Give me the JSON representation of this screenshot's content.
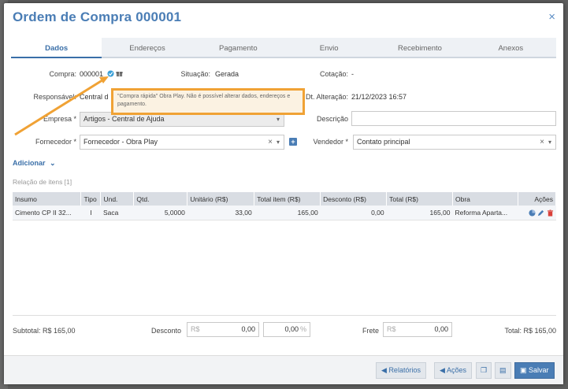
{
  "window": {
    "title": "Ordem de Compra 000001",
    "close": "×"
  },
  "tabs": [
    "Dados",
    "Endereços",
    "Pagamento",
    "Envio",
    "Recebimento",
    "Anexos"
  ],
  "header": {
    "compra_label": "Compra:",
    "compra_value": "000001",
    "situacao_label": "Situação:",
    "situacao_value": "Gerada",
    "cotacao_label": "Cotação:",
    "cotacao_value": "-",
    "responsavel_label": "Responsável:",
    "responsavel_value": "Central d",
    "dt_alteracao_label": "Dt. Alteração:",
    "dt_alteracao_value": "21/12/2023 16:57",
    "empresa_label": "Empresa *",
    "empresa_value": "Artigos - Central de Ajuda",
    "descricao_label": "Descrição",
    "fornecedor_label": "Fornecedor *",
    "fornecedor_value": "Fornecedor - Obra Play",
    "vendedor_label": "Vendedor *",
    "vendedor_value": "Contato principal",
    "clear_mark": "×",
    "caret": "▾",
    "plus": "+"
  },
  "tooltip": {
    "text": "\"Compra rápida\" Obra Play. Não é possível alterar dados, endereços e pagamento."
  },
  "adicionar": {
    "label": "Adicionar",
    "caret": "⌄"
  },
  "relacao": {
    "label": "Relação de itens [1]"
  },
  "table": {
    "headers": [
      "Insumo",
      "Tipo",
      "Und.",
      "Qtd.",
      "Unitário (R$)",
      "Total item (R$)",
      "Desconto (R$)",
      "Total (R$)",
      "Obra",
      "Ações"
    ],
    "rows": [
      [
        "Cimento CP II 32...",
        "I",
        "Saca",
        "5,0000",
        "33,00",
        "165,00",
        "0,00",
        "165,00",
        "Reforma Aparta..."
      ]
    ]
  },
  "footer": {
    "subtotal": "Subtotal: R$ 165,00",
    "desconto_label": "Desconto",
    "desconto_prefix": "R$",
    "desconto_value": "0,00",
    "desconto_pct_value": "0,00",
    "pct": "%",
    "frete_label": "Frete",
    "frete_prefix": "R$",
    "frete_value": "0,00",
    "total": "Total: R$ 165,00"
  },
  "buttons": {
    "relatorios": "Relatórios",
    "acoes": "Ações",
    "salvar": "Salvar"
  },
  "colors": {
    "accent": "#4a7db5",
    "tooltip_border": "#f0a235",
    "delete": "#d9403a"
  }
}
